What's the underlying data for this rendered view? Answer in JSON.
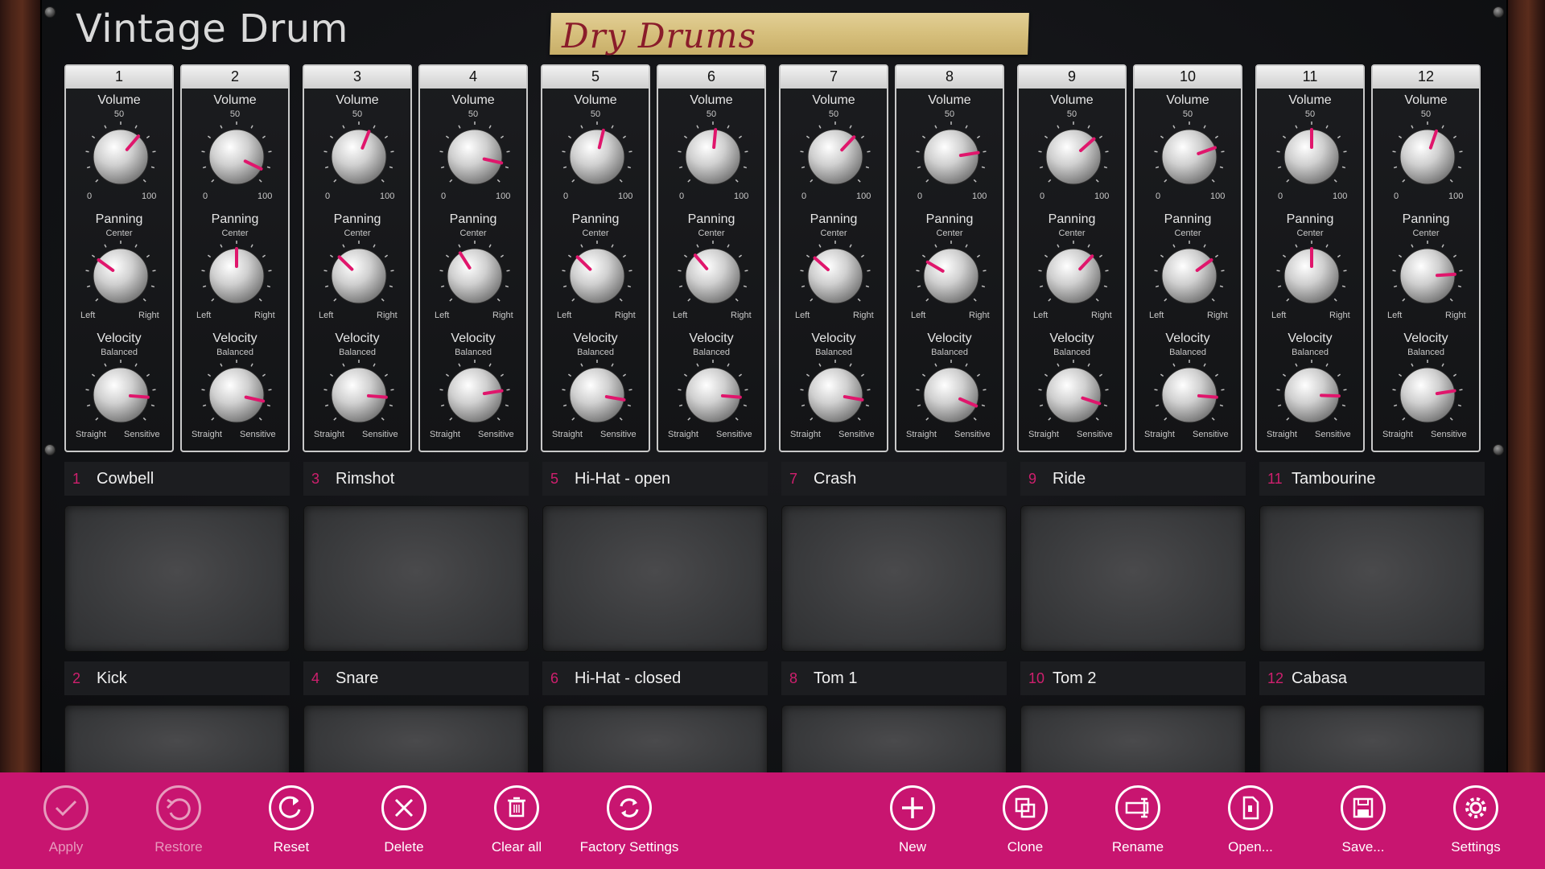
{
  "app": {
    "title": "Vintage Drum",
    "kit_name": "Dry Drums"
  },
  "colors": {
    "accent": "#c81570",
    "pointer": "#e0166c",
    "strip_border": "#c9c9c9"
  },
  "strip_labels": {
    "volume": "Volume",
    "volume_mid": "50",
    "volume_min": "0",
    "volume_max": "100",
    "panning": "Panning",
    "panning_mid": "Center",
    "panning_left": "Left",
    "panning_right": "Right",
    "velocity": "Velocity",
    "velocity_mid": "Balanced",
    "velocity_left": "Straight",
    "velocity_right": "Sensitive"
  },
  "channels": [
    {
      "number": "1",
      "volume": 65,
      "panning": 30,
      "velocity": 85
    },
    {
      "number": "2",
      "volume": 93,
      "panning": 50,
      "velocity": 88
    },
    {
      "number": "3",
      "volume": 58,
      "panning": 33,
      "velocity": 85
    },
    {
      "number": "4",
      "volume": 88,
      "panning": 38,
      "velocity": 80
    },
    {
      "number": "5",
      "volume": 55,
      "panning": 33,
      "velocity": 87
    },
    {
      "number": "6",
      "volume": 52,
      "panning": 35,
      "velocity": 85
    },
    {
      "number": "7",
      "volume": 66,
      "panning": 32,
      "velocity": 87
    },
    {
      "number": "8",
      "volume": 80,
      "panning": 28,
      "velocity": 92
    },
    {
      "number": "9",
      "volume": 68,
      "panning": 66,
      "velocity": 90
    },
    {
      "number": "10",
      "volume": 76,
      "panning": 70,
      "velocity": 85
    },
    {
      "number": "11",
      "volume": 50,
      "panning": 50,
      "velocity": 84
    },
    {
      "number": "12",
      "volume": 57,
      "panning": 82,
      "velocity": 80
    }
  ],
  "pads": [
    {
      "number": "1",
      "name": "Cowbell"
    },
    {
      "number": "3",
      "name": "Rimshot"
    },
    {
      "number": "5",
      "name": "Hi-Hat - open"
    },
    {
      "number": "7",
      "name": "Crash"
    },
    {
      "number": "9",
      "name": "Ride"
    },
    {
      "number": "11",
      "name": "Tambourine"
    },
    {
      "number": "2",
      "name": "Kick"
    },
    {
      "number": "4",
      "name": "Snare"
    },
    {
      "number": "6",
      "name": "Hi-Hat - closed"
    },
    {
      "number": "8",
      "name": "Tom 1"
    },
    {
      "number": "10",
      "name": "Tom 2"
    },
    {
      "number": "12",
      "name": "Cabasa"
    }
  ],
  "appbar": [
    {
      "label": "Apply",
      "icon": "check-icon",
      "enabled": false
    },
    {
      "label": "Restore",
      "icon": "undo-icon",
      "enabled": false
    },
    {
      "label": "Reset",
      "icon": "refresh-icon",
      "enabled": true
    },
    {
      "label": "Delete",
      "icon": "close-icon",
      "enabled": true
    },
    {
      "label": "Clear all",
      "icon": "trash-icon",
      "enabled": true
    },
    {
      "label": "Factory Settings",
      "icon": "sync-icon",
      "enabled": true
    },
    {
      "label": "New",
      "icon": "plus-icon",
      "enabled": true
    },
    {
      "label": "Clone",
      "icon": "clone-icon",
      "enabled": true
    },
    {
      "label": "Rename",
      "icon": "rename-icon",
      "enabled": true
    },
    {
      "label": "Open...",
      "icon": "open-file-icon",
      "enabled": true
    },
    {
      "label": "Save...",
      "icon": "save-icon",
      "enabled": true
    },
    {
      "label": "Settings",
      "icon": "gear-icon",
      "enabled": true
    }
  ]
}
